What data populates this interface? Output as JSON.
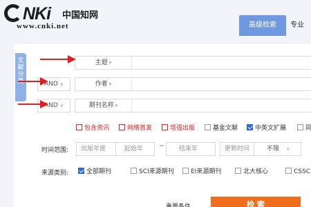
{
  "header": {
    "logo_text": "CNKi",
    "logo_cn": "中国知网",
    "logo_url": "www.cnki.net",
    "tabs": [
      {
        "label": "高级检索"
      },
      {
        "label": "专业"
      }
    ]
  },
  "side_tab": {
    "label": "文献分类"
  },
  "search_rows": [
    {
      "logic": "",
      "field": "主题"
    },
    {
      "logic": "AND",
      "field": "作者"
    },
    {
      "logic": "AND",
      "field": "期刊名称"
    }
  ],
  "options": [
    {
      "label": "包含资讯",
      "checked": false,
      "style": "red"
    },
    {
      "label": "网络首发",
      "checked": false,
      "style": "red"
    },
    {
      "label": "增强出版",
      "checked": false,
      "style": "red"
    },
    {
      "label": "基金文献",
      "checked": false,
      "style": "normal"
    },
    {
      "label": "中英文扩展",
      "checked": true,
      "style": "normal"
    },
    {
      "label": "同",
      "checked": false,
      "style": "normal"
    }
  ],
  "time": {
    "label": "时间范围:",
    "pub_year": "出版年度",
    "start_year": "起始年",
    "tilde": "~",
    "end_year": "结束年",
    "update_label": "更新时间",
    "update_value": "不限"
  },
  "source": {
    "label": "来源类别:",
    "items": [
      {
        "label": "全部期刊",
        "checked": true
      },
      {
        "label": "SCI来源期刊",
        "checked": false
      },
      {
        "label": "EI来源期刊",
        "checked": false
      },
      {
        "label": "北大核心",
        "checked": false
      },
      {
        "label": "CSSC",
        "checked": false
      }
    ]
  },
  "actions": {
    "reset": "重置条件",
    "search": "检  索"
  },
  "colors": {
    "accent_blue": "#6f98de",
    "search_orange": "#f06d1e",
    "annotation_red": "#e02020"
  }
}
